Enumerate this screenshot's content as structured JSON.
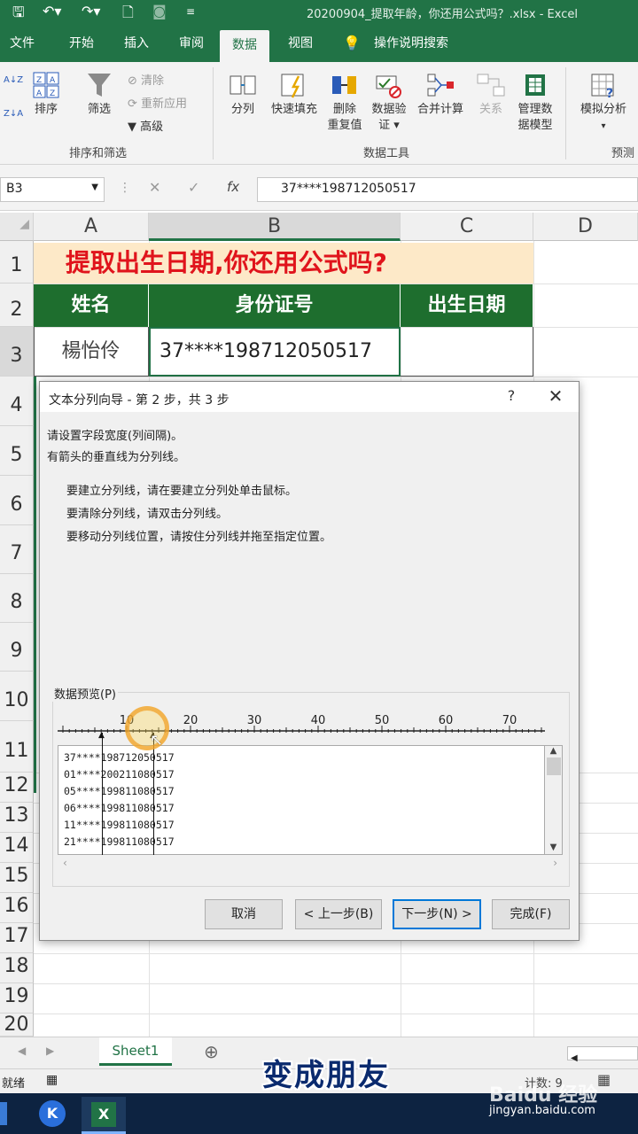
{
  "window": {
    "title": "20200904_提取年龄，你还用公式吗？.xlsx - Excel"
  },
  "tabs": [
    "文件",
    "开始",
    "插入",
    "审阅",
    "数据",
    "视图",
    "操作说明搜索"
  ],
  "ribbon": {
    "sort_asc": "A↓Z",
    "sort_desc": "Z↓A",
    "sort": "排序",
    "filter": "筛选",
    "clear": "清除",
    "reapply": "重新应用",
    "advanced": "高级",
    "group_sortfilter": "排序和筛选",
    "split": "分列",
    "flashfill": "快速填充",
    "remove_dup_1": "删除",
    "remove_dup_2": "重复值",
    "validate_1": "数据验",
    "validate_2": "证 ▾",
    "consolidate": "合并计算",
    "relations": "关系",
    "datamodel_1": "管理数",
    "datamodel_2": "据模型",
    "group_datatools": "数据工具",
    "whatif": "模拟分析",
    "whatif_arrow": "▾",
    "forecast": "预测"
  },
  "formula": {
    "namebox": "B3",
    "cancel": "✕",
    "confirm": "✓",
    "fx": "fx",
    "value": "37****198712050517"
  },
  "sheet": {
    "columns": [
      "A",
      "B",
      "C",
      "D"
    ],
    "rows": [
      "1",
      "2",
      "3",
      "4",
      "5",
      "6",
      "7",
      "8",
      "9",
      "10",
      "11",
      "12",
      "13",
      "14",
      "15",
      "16",
      "17",
      "18",
      "19",
      "20"
    ],
    "banner": "提取出生日期,你还用公式吗?",
    "headers": [
      "姓名",
      "身份证号",
      "出生日期"
    ],
    "name": "楊怡伶",
    "id": "37****198712050517"
  },
  "dialog": {
    "title": "文本分列向导 - 第 2 步，共 3 步",
    "help": "?",
    "close": "✕",
    "line1": "请设置字段宽度(列间隔)。",
    "line2": "有箭头的垂直线为分列线。",
    "hint1": "要建立分列线，请在要建立分列处单击鼠标。",
    "hint2": "要清除分列线，请双击分列线。",
    "hint3": "要移动分列线位置，请按住分列线并拖至指定位置。",
    "preview_label": "数据预览(P)",
    "ruler_ticks": [
      "10",
      "20",
      "30",
      "40",
      "50",
      "60",
      "70"
    ],
    "preview_rows": [
      "37****198712050517",
      "01****200211080517",
      "05****199811080517",
      "06****199811080517",
      "11****199811080517",
      "21****199811080517"
    ],
    "buttons": {
      "cancel": "取消",
      "back": "< 上一步(B)",
      "next": "下一步(N) >",
      "finish": "完成(F)"
    }
  },
  "sheettab": {
    "name": "Sheet1",
    "add": "⊕"
  },
  "status": {
    "ready": "就绪",
    "count": "计数: 9"
  },
  "caption": "变成朋友",
  "watermark": {
    "brand": "Baidu 经验",
    "url": "jingyan.baidu.com"
  }
}
